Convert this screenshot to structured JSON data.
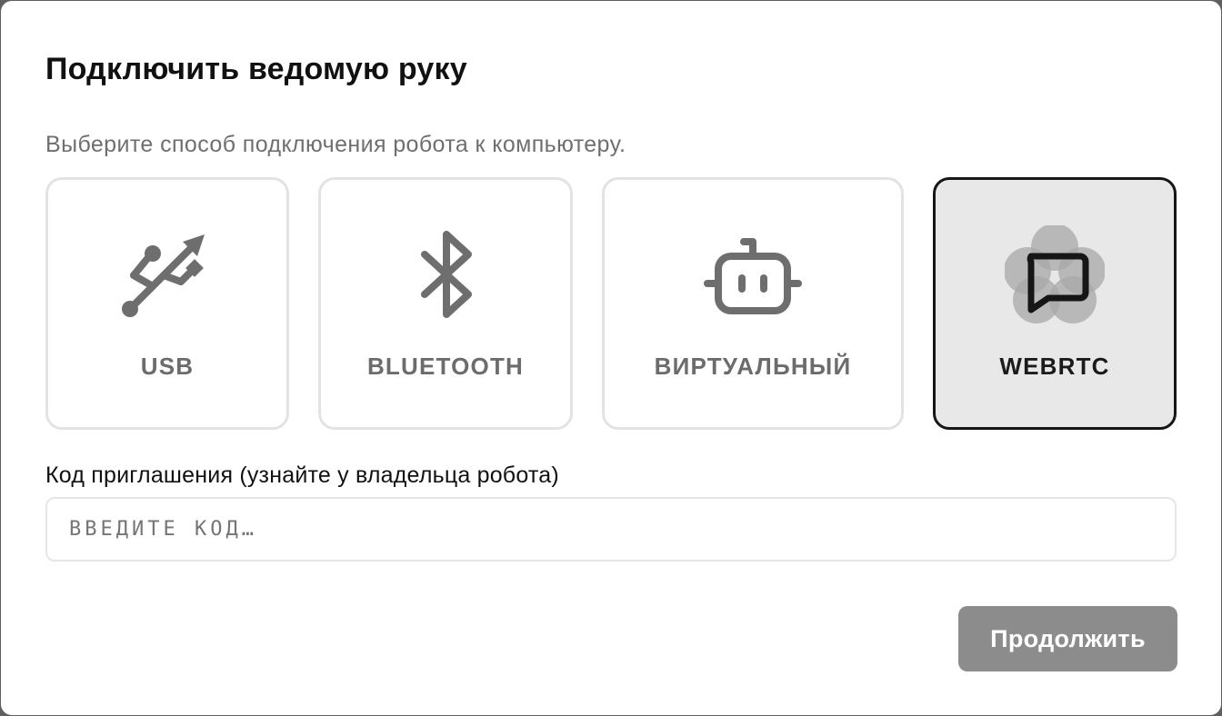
{
  "dialog": {
    "title": "Подключить ведомую руку",
    "subtitle": "Выберите способ подключения робота к компьютеру."
  },
  "methods": [
    {
      "id": "usb",
      "label": "USB",
      "icon": "usb-icon",
      "selected": false
    },
    {
      "id": "bluetooth",
      "label": "BLUETOOTH",
      "icon": "bluetooth-icon",
      "selected": false
    },
    {
      "id": "virtual",
      "label": "ВИРТУАЛЬНЫЙ",
      "icon": "robot-icon",
      "selected": false
    },
    {
      "id": "webrtc",
      "label": "WEBRTC",
      "icon": "chat-bubble-icon",
      "selected": true
    }
  ],
  "invite": {
    "label": "Код приглашения (узнайте у владельца робота)",
    "placeholder": "ВВЕДИТЕ КОД…",
    "value": ""
  },
  "actions": {
    "continue_label": "Продолжить"
  },
  "colors": {
    "card_border": "#e3e3e3",
    "card_selected_border": "#161616",
    "card_selected_bg": "#e8e8e8",
    "button_bg": "#8c8c8c",
    "icon_gray": "#6e6e6e"
  }
}
